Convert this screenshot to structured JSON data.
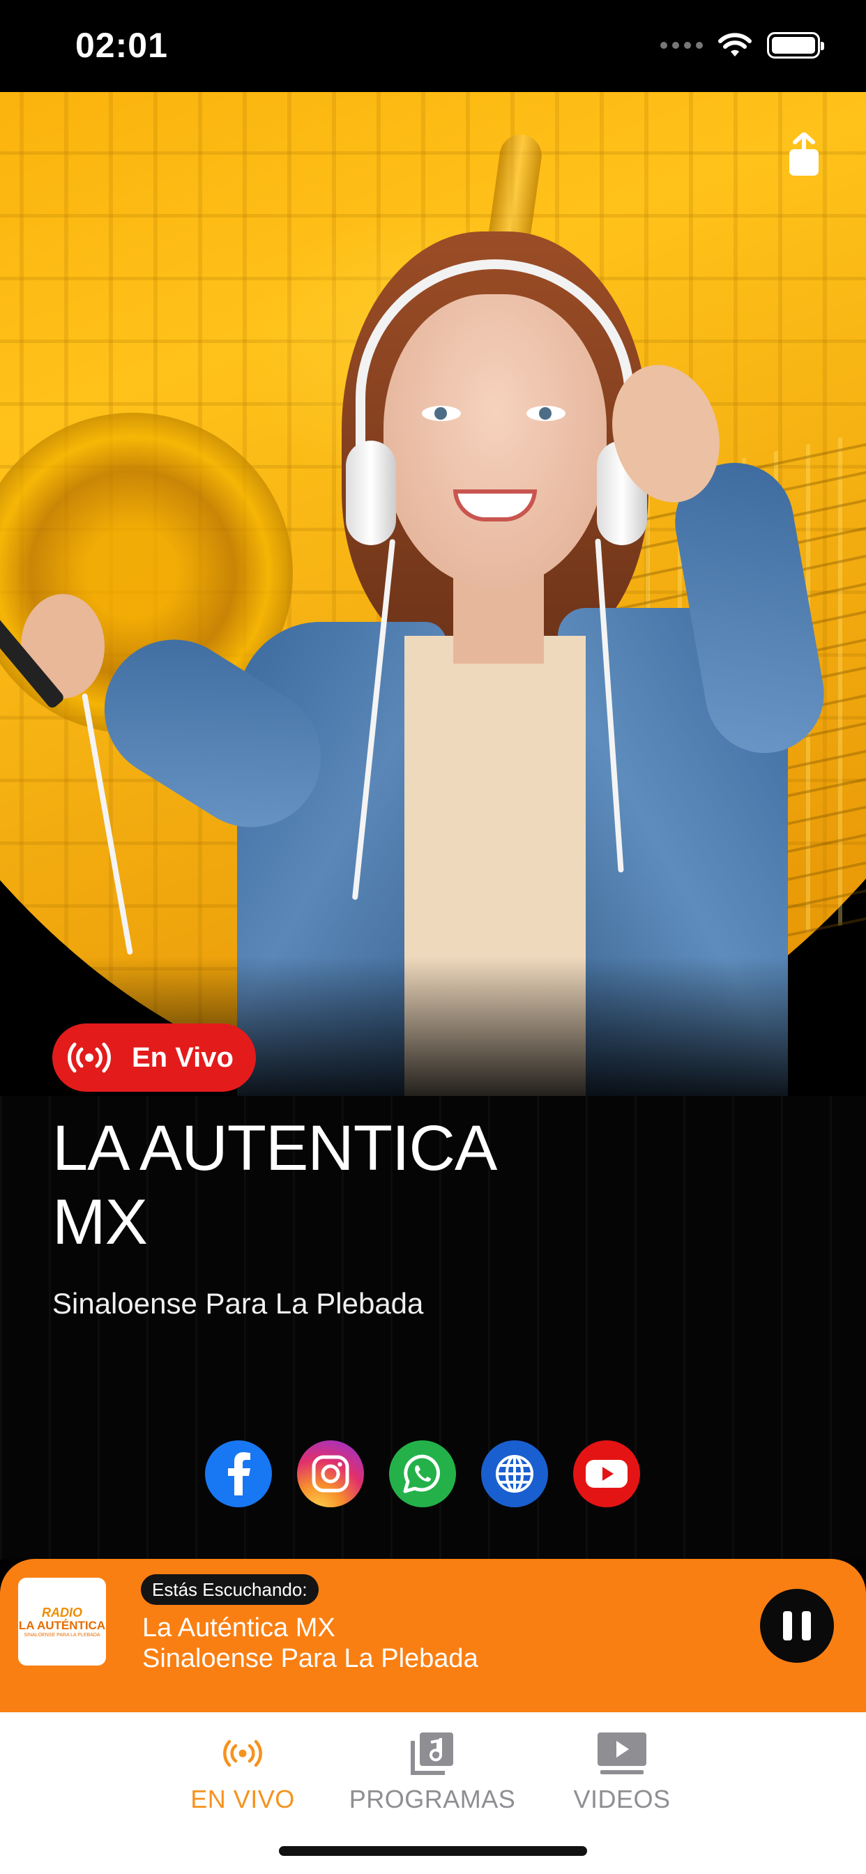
{
  "status_bar": {
    "time": "02:01",
    "icons": [
      "signal-icon",
      "wifi-icon",
      "battery-icon"
    ]
  },
  "hero": {
    "share_icon": "share-icon",
    "live_badge": {
      "label": "En Vivo",
      "icon": "broadcast-icon",
      "color": "#e31b1b"
    }
  },
  "station": {
    "title": "LA AUTENTICA MX",
    "subtitle": "Sinaloense Para La Plebada"
  },
  "social": [
    {
      "name": "facebook-icon",
      "color": "#1877f2"
    },
    {
      "name": "instagram-icon",
      "color": "#e1306c"
    },
    {
      "name": "whatsapp-icon",
      "color": "#24b14a"
    },
    {
      "name": "web-globe-icon",
      "color": "#1a5fd0"
    },
    {
      "name": "youtube-icon",
      "color": "#e51414"
    }
  ],
  "now_playing": {
    "label": "Estás Escuchando:",
    "title": "La Auténtica MX",
    "subtitle": "Sinaloense Para La Plebada",
    "logo": {
      "top": "RADIO",
      "main": "LA AUTÉNTICA",
      "tag": "SINALOENSE PARA LA PLEBADA"
    },
    "state": "playing",
    "control_icon": "pause-icon",
    "color": "#fa7f12"
  },
  "tabs": [
    {
      "label": "EN VIVO",
      "icon": "broadcast-icon",
      "active": true
    },
    {
      "label": "PROGRAMAS",
      "icon": "music-library-icon",
      "active": false
    },
    {
      "label": "VIDEOS",
      "icon": "video-play-icon",
      "active": false
    }
  ],
  "colors": {
    "accent": "#f5931f",
    "inactive": "#8e8e93"
  }
}
